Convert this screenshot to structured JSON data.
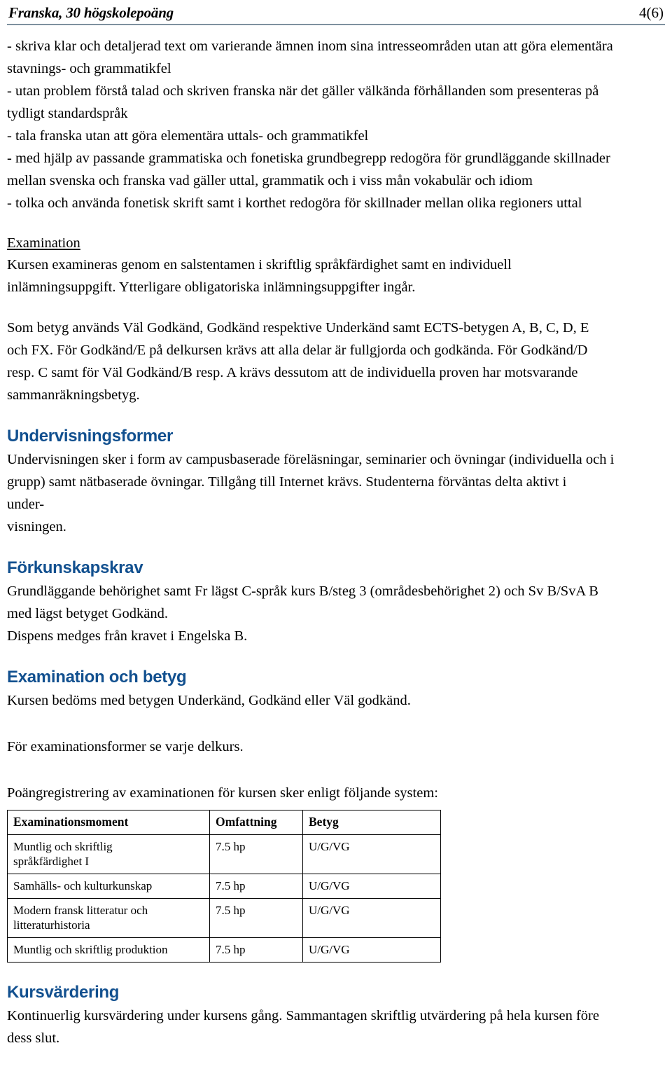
{
  "header": {
    "title": "Franska, 30 högskolepoäng",
    "page_label": "4(6)"
  },
  "goals_bullets": [
    "- skriva klar och detaljerad text om varierande ämnen inom sina intresseområden utan att göra elementära",
    "stavnings- och grammatikfel",
    "- utan problem förstå talad och skriven franska när det gäller välkända förhållanden som presenteras på",
    "tydligt standardspråk",
    "- tala franska utan att göra elementära uttals- och grammatikfel",
    "- med hjälp av passande grammatiska och fonetiska grundbegrepp redogöra för grundläggande skillnader",
    "mellan svenska och franska vad gäller uttal, grammatik och i viss mån vokabulär och idiom",
    "- tolka och använda fonetisk skrift samt i korthet redogöra för skillnader mellan olika regioners uttal"
  ],
  "examination_sub": {
    "heading": "Examination",
    "lines": [
      "Kursen examineras genom en salstentamen i skriftlig språkfärdighet samt en individuell",
      "inlämningsuppgift. Ytterligare obligatoriska inlämningsuppgifter ingår."
    ]
  },
  "betyg_paragraph": {
    "lines": [
      "Som betyg används Väl Godkänd, Godkänd respektive Underkänd samt ECTS-betygen A, B, C, D, E",
      "och FX. För Godkänd/E på delkursen krävs att alla delar är fullgjorda och godkända. För Godkänd/D",
      "resp. C samt för Väl Godkänd/B resp. A krävs dessutom att de individuella proven har motsvarande",
      "sammanräkningsbetyg."
    ]
  },
  "undervisningsformer": {
    "heading": "Undervisningsformer",
    "lines": [
      "Undervisningen sker i form av campusbaserade föreläsningar, seminarier och övningar (individuella och i",
      "grupp) samt nätbaserade övningar. Tillgång till Internet krävs. Studenterna förväntas delta aktivt i",
      "under-",
      "visningen."
    ]
  },
  "forkunskapskrav": {
    "heading": "Förkunskapskrav",
    "lines": [
      "Grundläggande behörighet samt Fr lägst C-språk kurs B/steg 3 (områdesbehörighet 2) och Sv B/SvA B",
      "med lägst betyget Godkänd.",
      "Dispens medges från kravet i Engelska B."
    ]
  },
  "examination_och_betyg": {
    "heading": "Examination och betyg",
    "lines": [
      "Kursen bedöms med betygen Underkänd, Godkänd eller Väl godkänd."
    ],
    "lines2": [
      "För examinationsformer se varje delkurs."
    ]
  },
  "poangregistrering": {
    "intro": "Poängregistrering av examinationen för kursen sker enligt följande system:",
    "columns": [
      "Examinationsmoment",
      "Omfattning",
      "Betyg"
    ],
    "rows": [
      {
        "moment_line1": "Muntlig och skriftlig",
        "moment_line2": "språkfärdighet I",
        "omfattning": "7.5 hp",
        "betyg": "U/G/VG"
      },
      {
        "moment_line1": "Samhälls- och kulturkunskap",
        "moment_line2": "",
        "omfattning": "7.5 hp",
        "betyg": "U/G/VG"
      },
      {
        "moment_line1": "Modern fransk litteratur och",
        "moment_line2": "litteraturhistoria",
        "omfattning": "7.5 hp",
        "betyg": "U/G/VG"
      },
      {
        "moment_line1": "Muntlig och skriftlig produktion",
        "moment_line2": "",
        "omfattning": "7.5 hp",
        "betyg": "U/G/VG"
      }
    ]
  },
  "kursvardering": {
    "heading": "Kursvärdering",
    "lines": [
      "Kontinuerlig kursvärdering under kursens gång. Sammantagen skriftlig utvärdering på hela kursen före",
      "dess slut."
    ]
  },
  "colors": {
    "heading_blue": "#12508f",
    "header_rule": "#7e919f",
    "text": "#000000",
    "page_background": "#ffffff"
  }
}
